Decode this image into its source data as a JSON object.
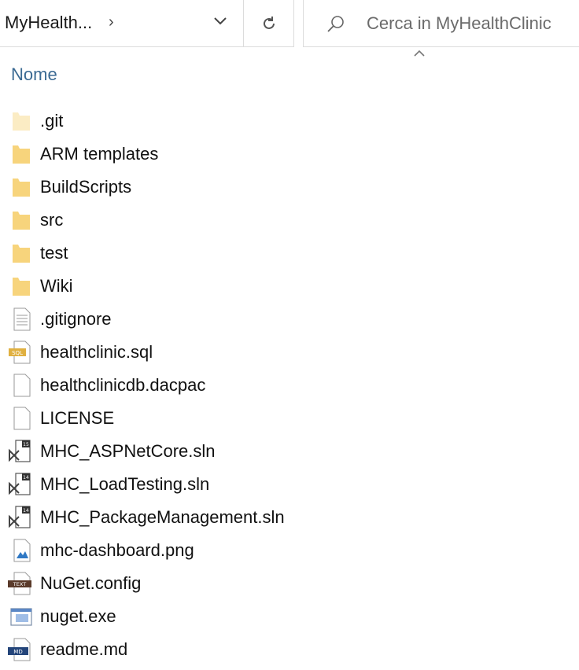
{
  "address": {
    "current_folder": "MyHealth...",
    "separator": "›"
  },
  "search": {
    "placeholder": "Cerca in MyHealthClinic"
  },
  "columns": {
    "name_header": "Nome"
  },
  "files": [
    {
      "name": ".git",
      "icon": "folder-hidden-icon"
    },
    {
      "name": "ARM templates",
      "icon": "folder-icon"
    },
    {
      "name": "BuildScripts",
      "icon": "folder-icon"
    },
    {
      "name": "src",
      "icon": "folder-icon"
    },
    {
      "name": "test",
      "icon": "folder-icon"
    },
    {
      "name": "Wiki",
      "icon": "folder-icon"
    },
    {
      "name": ".gitignore",
      "icon": "text-file-icon"
    },
    {
      "name": "healthclinic.sql",
      "icon": "sql-file-icon"
    },
    {
      "name": "healthclinicdb.dacpac",
      "icon": "blank-file-icon"
    },
    {
      "name": "LICENSE",
      "icon": "blank-file-icon"
    },
    {
      "name": "MHC_ASPNetCore.sln",
      "icon": "vs-solution-15-icon"
    },
    {
      "name": "MHC_LoadTesting.sln",
      "icon": "vs-solution-14-icon"
    },
    {
      "name": "MHC_PackageManagement.sln",
      "icon": "vs-solution-14-icon"
    },
    {
      "name": "mhc-dashboard.png",
      "icon": "image-file-icon"
    },
    {
      "name": "NuGet.config",
      "icon": "config-file-icon"
    },
    {
      "name": "nuget.exe",
      "icon": "exe-file-icon"
    },
    {
      "name": "readme.md",
      "icon": "markdown-file-icon"
    }
  ],
  "colors": {
    "header_text": "#3b6a93",
    "folder": "#f7d47c",
    "border": "#dcdcdc"
  }
}
